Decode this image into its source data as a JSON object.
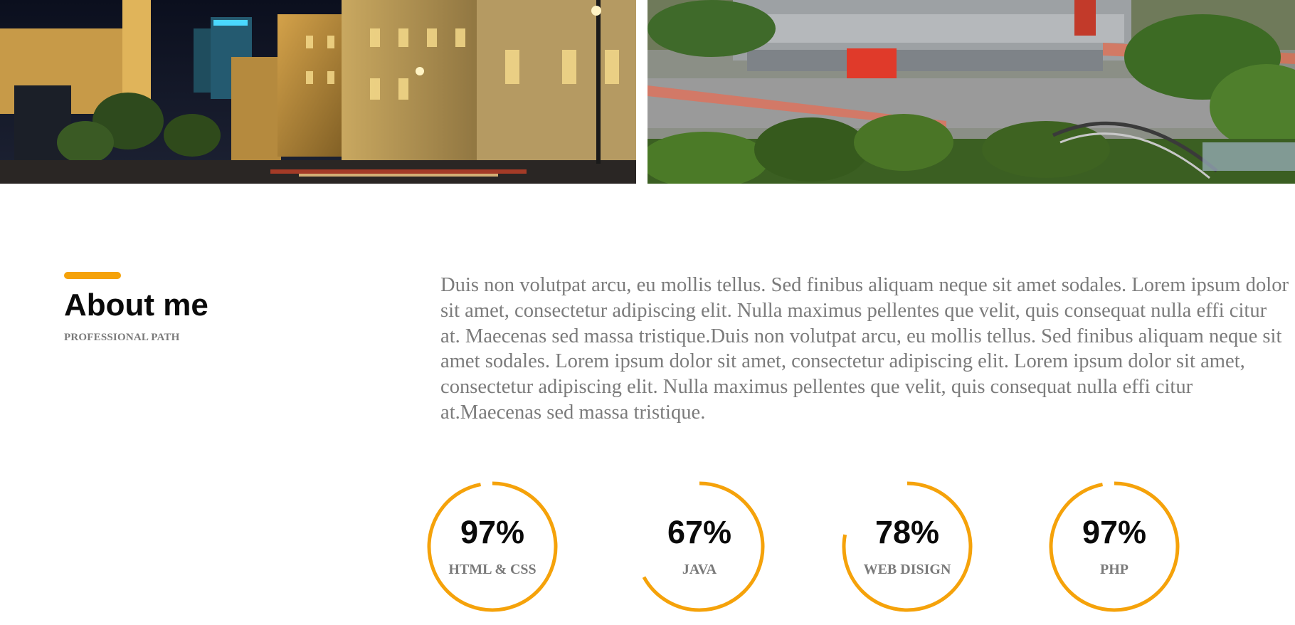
{
  "gallery": {
    "left_image": "night city street photo",
    "right_image": "stadium and park aerial photo"
  },
  "about": {
    "title": "About me",
    "subtitle": "PROFESSIONAL PATH",
    "text": "Duis non volutpat arcu, eu mollis tellus. Sed finibus aliquam neque sit amet sodales. Lorem ipsum dolor sit amet, consectetur adipiscing elit. Nulla maximus pellentes que velit, quis consequat nulla effi citur at. Maecenas sed massa tristique.Duis non volutpat arcu, eu mollis tellus. Sed finibus aliquam neque sit amet sodales. Lorem ipsum dolor sit amet, consectetur adipiscing elit. Lorem ipsum dolor sit amet, consectetur adipiscing elit. Nulla maximus pellentes que velit, quis consequat nulla effi citur at.Maecenas sed massa tristique."
  },
  "skills": [
    {
      "label": "97%",
      "name": "HTML & CSS",
      "percent": 97
    },
    {
      "label": "67%",
      "name": "JAVA",
      "percent": 67
    },
    {
      "label": "78%",
      "name": "WEB DISIGN",
      "percent": 78
    },
    {
      "label": "97%",
      "name": "PHP",
      "percent": 97
    }
  ],
  "colors": {
    "accent": "#f5a20a",
    "heading": "#0a0a0a",
    "muted": "#7b7b7b"
  }
}
